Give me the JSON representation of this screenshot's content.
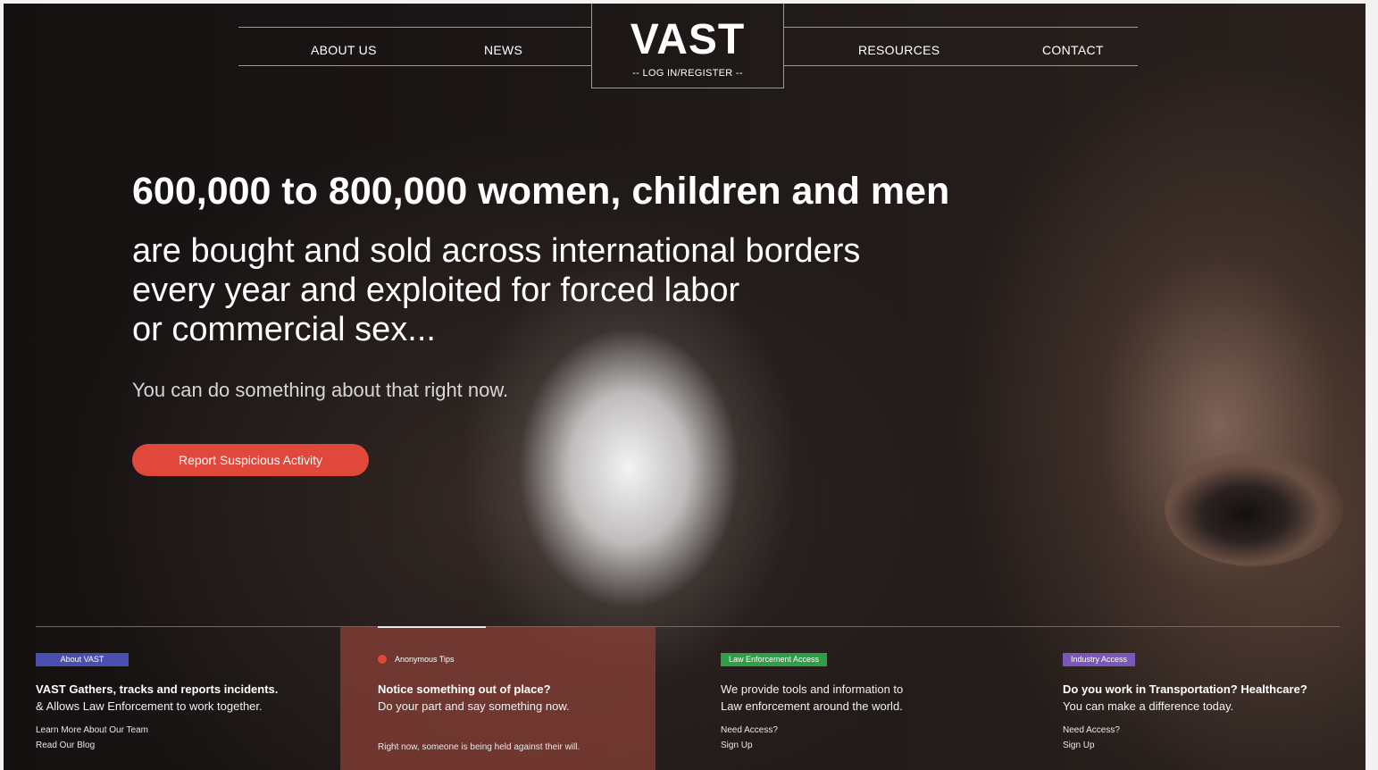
{
  "nav": {
    "left": [
      "ABOUT US",
      "NEWS"
    ],
    "right": [
      "RESOURCES",
      "CONTACT"
    ],
    "logo": "VAST",
    "login": "-- LOG IN/REGISTER --"
  },
  "hero": {
    "headline": "600,000 to 800,000 women, children and men",
    "sub_lines": [
      "are bought and sold across international borders",
      "every year and exploited for forced labor",
      "or commercial sex..."
    ],
    "tagline": "You can do something about that right now.",
    "cta": "Report Suspicious Activity"
  },
  "cards": [
    {
      "tag": "About VAST",
      "tag_color": "#4a4fae",
      "title": "VAST Gathers, tracks and reports incidents.",
      "text": "& Allows Law Enforcement to work together.",
      "links": [
        "Learn More About Our Team",
        "Read Our Blog"
      ]
    },
    {
      "tag": "Anonymous Tips",
      "title": "Notice something out of place?",
      "text": "Do your part and say something now.",
      "footer": "Right now, someone is being held against their will."
    },
    {
      "tag": "Law Enforcement Access",
      "tag_color": "#2f9e46",
      "text_lines": [
        "We provide tools and information to",
        "Law enforcement around the world."
      ],
      "links": [
        "Need Access?",
        "Sign Up"
      ]
    },
    {
      "tag": "Industry Access",
      "tag_color": "#7b57b7",
      "title": "Do you work in Transportation?  Healthcare?",
      "text": "You can make a difference today.",
      "links": [
        "Need Access?",
        "Sign Up"
      ]
    }
  ],
  "colors": {
    "accent": "#e0483b",
    "highlight_card": "#8c4137"
  }
}
